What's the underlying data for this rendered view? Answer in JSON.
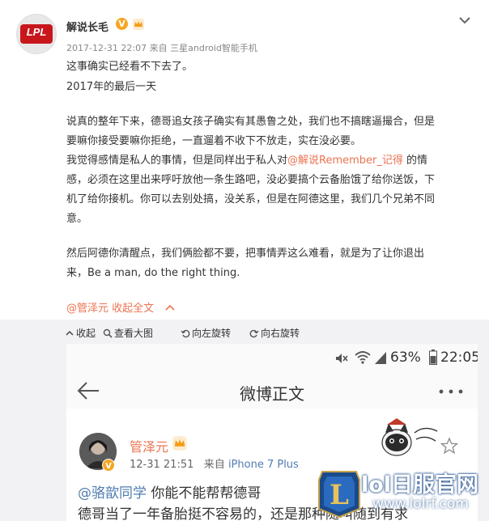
{
  "post": {
    "author": "解说长毛",
    "verified_badge": "V",
    "avatar_logo": "LPL",
    "timestamp": "2017-12-31 22:07",
    "source_prefix": "来自",
    "source": "三星android智能手机",
    "lines": [
      "这事确实已经看不下去了。",
      "2017年的最后一天",
      "说真的整年下来，德哥追女孩子确实有其愚鲁之处，我们也不搞瞎逼撮合，但是",
      "要嘛你接受要嘛你拒绝，一直遛着不收下不放走，实在没必要。",
      "我觉得感情是私人的事情，但是同样出于私人对",
      "感，必须在这里出来呼吁放他一条生路吧，没必要搞个云备胎饿了给你送饭，下",
      "机了给你接机。你可以去别处搞，没关系，但是在阿德这里，我们几个兄弟不同",
      "意。",
      "然后阿德你清醒点，我们俩脸都不要，把事情弄这么难看，就是为了让你退出",
      "来，Be a man, do the right thing."
    ],
    "mention_remember": "@解说Remember_记得",
    "after_mention": " 的情",
    "footer_mention": "@管泽元",
    "collapse_label": "收起全文",
    "colors": {
      "link": "#eb7350",
      "blue_link": "#507daf",
      "toolbar_bg": "#f2f2f5"
    }
  },
  "toolbar": {
    "collapse": "收起",
    "view_large": "查看大图",
    "rotate_left": "向左旋转",
    "rotate_right": "向右旋转"
  },
  "phone": {
    "battery": "63%",
    "time": "22:05",
    "nav_title": "微博正文",
    "repost_author": "管泽元",
    "repost_time": "12-31 21:51",
    "repost_source_prefix": "来自",
    "repost_source": "iPhone 7 Plus",
    "repost_mention": "@骆歆同学",
    "repost_line1_rest": " 你能不能帮帮德哥",
    "repost_line2": "德哥当了一年备胎挺不容易的，还是那种随叫随到有求"
  },
  "watermark": {
    "title": "lol日服官网",
    "url": "www.lolrf.com"
  }
}
